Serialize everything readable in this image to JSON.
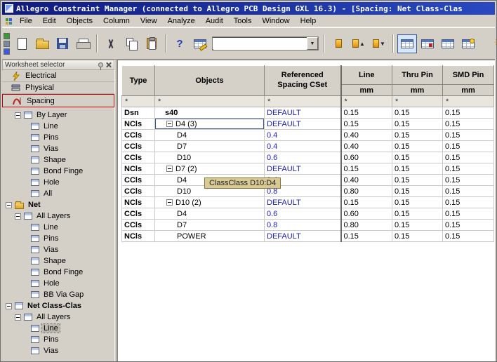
{
  "window": {
    "title": "Allegro Constraint Manager (connected to Allegro PCB Design GXL 16.3) - [Spacing:  Net Class-Clas"
  },
  "menu": {
    "items": [
      "File",
      "Edit",
      "Objects",
      "Column",
      "View",
      "Analyze",
      "Audit",
      "Tools",
      "Window",
      "Help"
    ]
  },
  "toolbar": {
    "combo_value": "",
    "glyphs": {
      "help": "?",
      "combo_arrow": "▼",
      "arrow_up": "▲",
      "arrow_down": "▼",
      "sun": "☀"
    },
    "icons": [
      "new",
      "open",
      "save",
      "print",
      "cut",
      "copy",
      "paste",
      "help",
      "goto-cell",
      "find-combo",
      "bookmark",
      "bookmark-up",
      "bookmark-down",
      "worksheet-selector",
      "table-red",
      "table-grid",
      "table-star",
      "analyze-sun"
    ]
  },
  "sidebar": {
    "header": "Worksheet selector",
    "buttons": [
      {
        "label": "Electrical"
      },
      {
        "label": "Physical"
      },
      {
        "label": "Spacing"
      }
    ],
    "tree": [
      {
        "label": "By Layer"
      },
      {
        "label": "Line"
      },
      {
        "label": "Pins"
      },
      {
        "label": "Vias"
      },
      {
        "label": "Shape"
      },
      {
        "label": "Bond Finge"
      },
      {
        "label": "Hole"
      },
      {
        "label": "All"
      },
      {
        "label": "Net"
      },
      {
        "label": "All Layers"
      },
      {
        "label": "Line"
      },
      {
        "label": "Pins"
      },
      {
        "label": "Vias"
      },
      {
        "label": "Shape"
      },
      {
        "label": "Bond Finge"
      },
      {
        "label": "Hole"
      },
      {
        "label": "BB Via Gap"
      },
      {
        "label": "Net Class-Clas"
      },
      {
        "label": "All Layers"
      },
      {
        "label": "Line"
      },
      {
        "label": "Pins"
      },
      {
        "label": "Vias"
      }
    ]
  },
  "table": {
    "columns": [
      "Type",
      "Objects",
      "Referenced Spacing CSet",
      "Line",
      "Thru Pin",
      "SMD Pin"
    ],
    "unit": "mm",
    "filter": "*",
    "rows": [
      {
        "type": "Dsn",
        "object": "s40",
        "ref": "DEFAULT",
        "line": "0.15",
        "thru": "0.15",
        "smd": "0.15"
      },
      {
        "type": "NCls",
        "object": "D4 (3)",
        "ref": "DEFAULT",
        "line": "0.15",
        "thru": "0.15",
        "smd": "0.15"
      },
      {
        "type": "CCls",
        "object": "D4",
        "ref": "0.4",
        "line": "0.40",
        "thru": "0.15",
        "smd": "0.15"
      },
      {
        "type": "CCls",
        "object": "D7",
        "ref": "0.4",
        "line": "0.40",
        "thru": "0.15",
        "smd": "0.15"
      },
      {
        "type": "CCls",
        "object": "D10",
        "ref": "0.6",
        "line": "0.60",
        "thru": "0.15",
        "smd": "0.15"
      },
      {
        "type": "NCls",
        "object": "D7 (2)",
        "ref": "DEFAULT",
        "line": "0.15",
        "thru": "0.15",
        "smd": "0.15"
      },
      {
        "type": "CCls",
        "object": "D4",
        "ref": "0.4",
        "line": "0.40",
        "thru": "0.15",
        "smd": "0.15"
      },
      {
        "type": "CCls",
        "object": "D10",
        "ref": "0.8",
        "line": "0.80",
        "thru": "0.15",
        "smd": "0.15"
      },
      {
        "type": "NCls",
        "object": "D10 (2)",
        "ref": "DEFAULT",
        "line": "0.15",
        "thru": "0.15",
        "smd": "0.15"
      },
      {
        "type": "CCls",
        "object": "D4",
        "ref": "0.6",
        "line": "0.60",
        "thru": "0.15",
        "smd": "0.15"
      },
      {
        "type": "CCls",
        "object": "D7",
        "ref": "0.8",
        "line": "0.80",
        "thru": "0.15",
        "smd": "0.15"
      },
      {
        "type": "NCls",
        "object": "POWER",
        "ref": "DEFAULT",
        "line": "0.15",
        "thru": "0.15",
        "smd": "0.15"
      }
    ]
  },
  "tooltip": {
    "text": "ClassClass D10:D4"
  },
  "colors": {
    "link_blue": "#2020b0",
    "selection_blue": "#a9c4ea",
    "chrome_gray": "#d4d0c8",
    "selected_red": "#c00000",
    "titlebar_blue": "#101b80"
  }
}
